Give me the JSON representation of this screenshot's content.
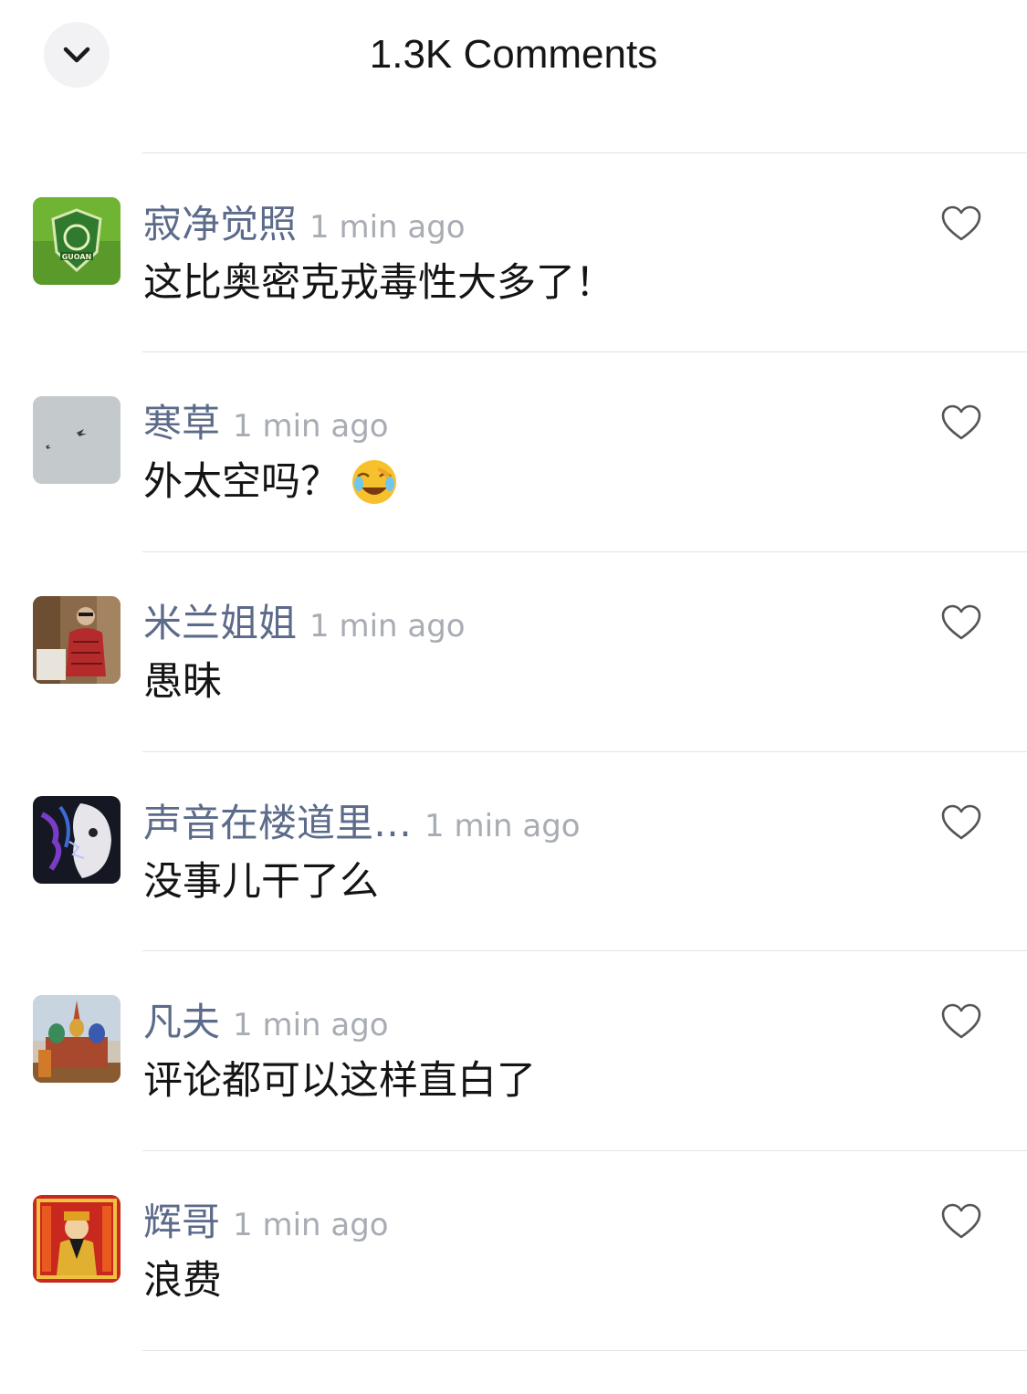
{
  "header": {
    "title": "1.3K Comments",
    "collapse_icon": "chevron-down-icon"
  },
  "comments": [
    {
      "username": "寂净觉照",
      "time": "1 min ago",
      "text": "这比奥密克戎毒性大多了！",
      "avatar": "football-club-badge"
    },
    {
      "username": "寒草",
      "time": "1 min ago",
      "text": "外太空吗？",
      "emoji": "laughing-crying-emoji",
      "avatar": "birds-in-sky"
    },
    {
      "username": "米兰姐姐",
      "time": "1 min ago",
      "text": "愚昧",
      "avatar": "woman-portrait"
    },
    {
      "username": "声音在楼道里…",
      "time": "1 min ago",
      "text": "没事儿干了么",
      "avatar": "artistic-face"
    },
    {
      "username": "凡夫",
      "time": "1 min ago",
      "text": "评论都可以这样直白了",
      "avatar": "cathedral"
    },
    {
      "username": "辉哥",
      "time": "1 min ago",
      "text": "浪费",
      "avatar": "god-of-wealth"
    }
  ],
  "colors": {
    "username": "#5c6b8a",
    "timestamp": "#a8acb3",
    "divider": "#e2e2e2",
    "collapse_button_bg": "#f2f2f4"
  }
}
